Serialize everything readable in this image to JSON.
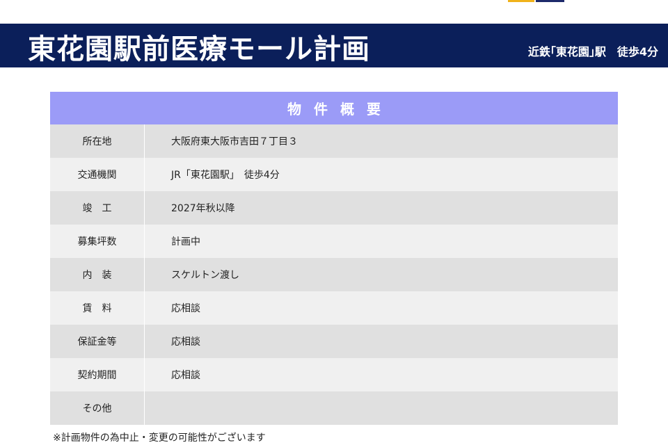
{
  "header": {
    "title": "東花園駅前医療モール計画",
    "access": "近鉄｢東花園｣駅　徒歩4分",
    "logo_colors": [
      "#f0b21a",
      "#1d2a6b"
    ]
  },
  "overview": {
    "heading": "物件概要",
    "rows": [
      {
        "label": "所在地",
        "value": "大阪府東大阪市吉田７丁目３"
      },
      {
        "label": "交通機関",
        "value": "JR「東花園駅」　徒歩4分"
      },
      {
        "label": "竣　工",
        "value": "2027年秋以降"
      },
      {
        "label": "募集坪数",
        "value": "計画中"
      },
      {
        "label": "内　装",
        "value": "スケルトン渡し"
      },
      {
        "label": "賃　料",
        "value": "応相談"
      },
      {
        "label": "保証金等",
        "value": "応相談"
      },
      {
        "label": "契約期間",
        "value": "応相談"
      },
      {
        "label": "その他",
        "value": ""
      }
    ]
  },
  "note": "※計画物件の為中止・変更の可能性がございます",
  "colors": {
    "title_bar": "#0b1f5a",
    "table_heading": "#9b9bf7",
    "row_dark": "#e0e0e0",
    "row_light": "#f0f0f0"
  }
}
